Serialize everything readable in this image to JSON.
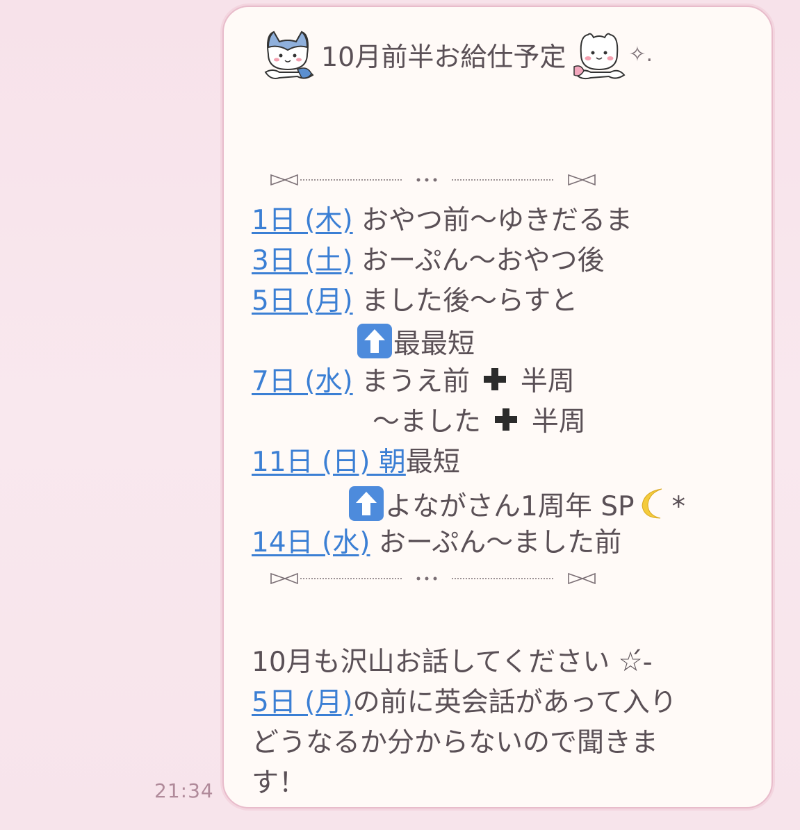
{
  "message": {
    "time": "21:34",
    "title": "10月前半お給仕予定",
    "title_suffix": "✧.",
    "lines": [
      {
        "date": "1日 (木)",
        "text": " おやつ前〜ゆきだるま"
      },
      {
        "date": "3日 (土)",
        "text": " おーぷん〜おやつ後"
      },
      {
        "date": "5日 (月)",
        "text": " ました後〜らすと"
      },
      {
        "arrow_text": "最最短"
      },
      {
        "date": "7日 (水)",
        "text_a": " まうえ前",
        "text_b": " 半周"
      },
      {
        "text_a": "〜ました",
        "text_b": " 半周"
      },
      {
        "date": "11日 (日)  朝",
        "text": "最短"
      },
      {
        "arrow_text": "よながさん1周年 SP",
        "suffix": "*"
      },
      {
        "date": "14日 (水)",
        "text": " おーぷん〜ました前"
      }
    ],
    "divider_dots": "…",
    "closing_line1": "10月も沢山お話してください ☆́-",
    "closing_date": "5日 (月)",
    "closing_line2_rest": "の前に英会話があって入り",
    "closing_line3": "どうなるか分からないので聞きま",
    "closing_line4": "す！"
  },
  "colors": {
    "background": "#f8e4ec",
    "bubble": "#fffaf7",
    "bubble_border": "#e8bccb",
    "text": "#5a5056",
    "link": "#3b7fd4",
    "timestamp": "#b08a9a"
  }
}
